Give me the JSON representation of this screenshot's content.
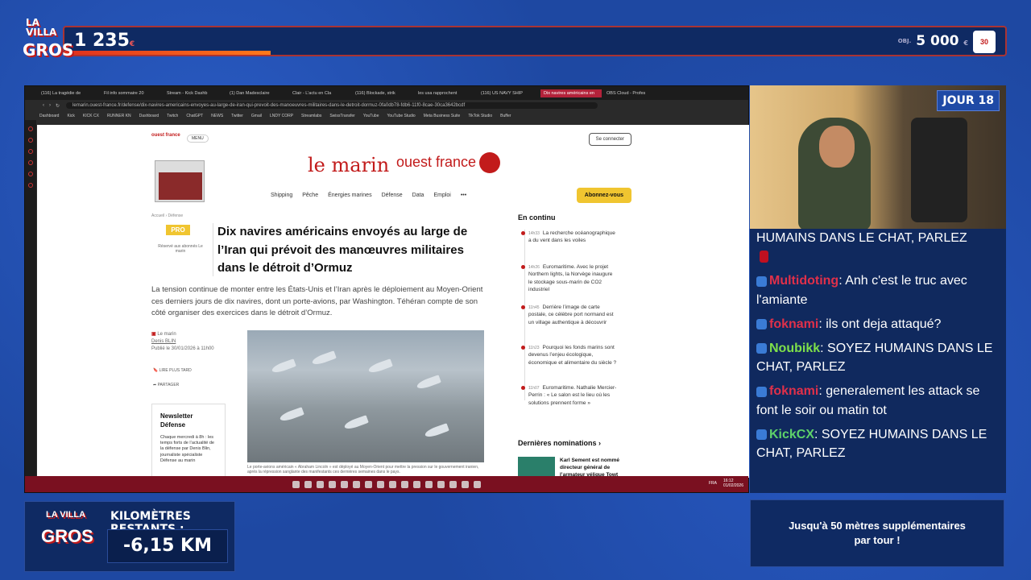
{
  "overlay": {
    "logo_top": "LA VILLA",
    "logo_bottom": "GROS",
    "logo_mid": "DES",
    "counter": "1 235",
    "counter_unit": "€",
    "goal_label": "OBJ.",
    "goal": "5 000",
    "goal_unit": "€",
    "badge": "30",
    "day": "JOUR 18",
    "km_label": "KILOMÈTRES RESTANTS :",
    "km_value": "-6,15 KM",
    "bonus": "Jusqu'à 50 mètres supplémentaires par tour !"
  },
  "browser": {
    "tabs": [
      "(116) La tragédie de",
      "Fil info sommaire 20",
      "Stream - Kick Dashb",
      "(1) Dan Madesclaire",
      "Clair - L'actu en Cla",
      "(116) Blockade, strik",
      "les usa rapprochent",
      "(116) US NAVY SHIP",
      "Dix navires américains en",
      "OBS Cloud - Profes"
    ],
    "active_tab": 8,
    "url": "lemarin.ouest-france.fr/defense/dix-navires-americains-envoyes-au-large-de-iran-qui-prevoit-des-manoeuvres-militaires-dans-le-detroit-dormuz-0fa0db78-fdb6-11f0-8cae-30ca3642bcdf",
    "bookmarks": [
      "Dashboard",
      "Kick",
      "KICK CX",
      "RUNNER KN",
      "Dashboard",
      "Twitch",
      "ChatGPT",
      "NEWS",
      "Twitter",
      "Gmail",
      "LNDY CORP",
      "Streamlabs",
      "SwissTransfer",
      "YouTube",
      "YouTube Studio",
      "Meta Business Suite",
      "TikTok Studio",
      "Buffer"
    ]
  },
  "site": {
    "topbrand": "ouest france",
    "menu": "MENU",
    "connect": "Se connecter",
    "brand": "le marin",
    "brand2": "ouest france",
    "nav": [
      "Shipping",
      "Pêche",
      "Énergies marines",
      "Défense",
      "Data",
      "Emploi",
      "•••"
    ],
    "subscribe": "Abonnez-vous",
    "crumb": "Accueil  ›  Défense",
    "pro": "PRO",
    "pro_note": "Réservé aux abonnés Le marin",
    "title": "Dix navires américains envoyés au large de l’Iran qui prévoit des manœuvres militaires dans le détroit d’Ormuz",
    "lead": "La tension continue de monter entre les États-Unis et l’Iran après le déploiement au Moyen-Orient ces derniers jours de dix navires, dont un porte-avions, par Washington. Téhéran compte de son côté organiser des exercices dans le détroit d’Ormuz.",
    "source": "Le marin",
    "author": "Denis BLIN",
    "published": "Publié le 30/01/2026 à 11h00",
    "read_later": "LIRE PLUS TARD",
    "share": "PARTAGER",
    "newsletter_title": "Newsletter Défense",
    "newsletter_text": "Chaque mercredi à 8h : les temps forts de l’actualité de la défense par Denis Blin, journaliste spécialiste Défense au marin",
    "caption": "Le porte-avions américain « Abraham Lincoln » est déployé au Moyen-Orient pour mettre la pression sur le gouvernement iranien, après la répression sanglante des manifestants ces dernières semaines dans le pays.",
    "en_continu": "En continu",
    "feed": [
      {
        "time": "14h33",
        "text": "La recherche océanographique a du vent dans les voiles"
      },
      {
        "time": "14h26",
        "text": "Euromaritime. Avec le projet Northern lights, la Norvège inaugure le stockage sous-marin de CO2 industriel"
      },
      {
        "time": "11h45",
        "text": "Derrière l’image de carte postale, ce célèbre port normand est un village authentique à découvrir"
      },
      {
        "time": "11h23",
        "text": "Pourquoi les fonds marins sont devenus l’enjeu écologique, économique et alimentaire du siècle ?"
      },
      {
        "time": "11h07",
        "text": "Euromaritime. Nathalie Mercier-Perrin : « Le salon est le lieu où les solutions prennent forme »"
      }
    ],
    "nominations": "Dernières nominations ›",
    "nomination_text": "Karl Sement est nommé directeur général de l’armateur vélique Towt"
  },
  "taskbar": {
    "lang": "FRA",
    "time": "16:12",
    "date": "01/02/2026"
  },
  "chat": [
    {
      "user": "",
      "text": "HUMAINS DANS LE CHAT, PARLEZ",
      "color": "#ffffff",
      "emote": true
    },
    {
      "user": "Multidoting",
      "text": ": Anh c'est le truc avec l'amiante",
      "color": "#e0304a"
    },
    {
      "user": "foknami",
      "text": ": ils ont deja attaqué?",
      "color": "#e0304a"
    },
    {
      "user": "Noubikk",
      "text": ":  SOYEZ HUMAINS DANS LE CHAT, PARLEZ",
      "color": "#7ee04a"
    },
    {
      "user": "foknami",
      "text": ": generalement les attack se font le soir ou matin tot",
      "color": "#e0304a"
    },
    {
      "user": "KickCX",
      "text": ":  SOYEZ HUMAINS DANS LE CHAT, PARLEZ",
      "color": "#5ed26a"
    }
  ]
}
